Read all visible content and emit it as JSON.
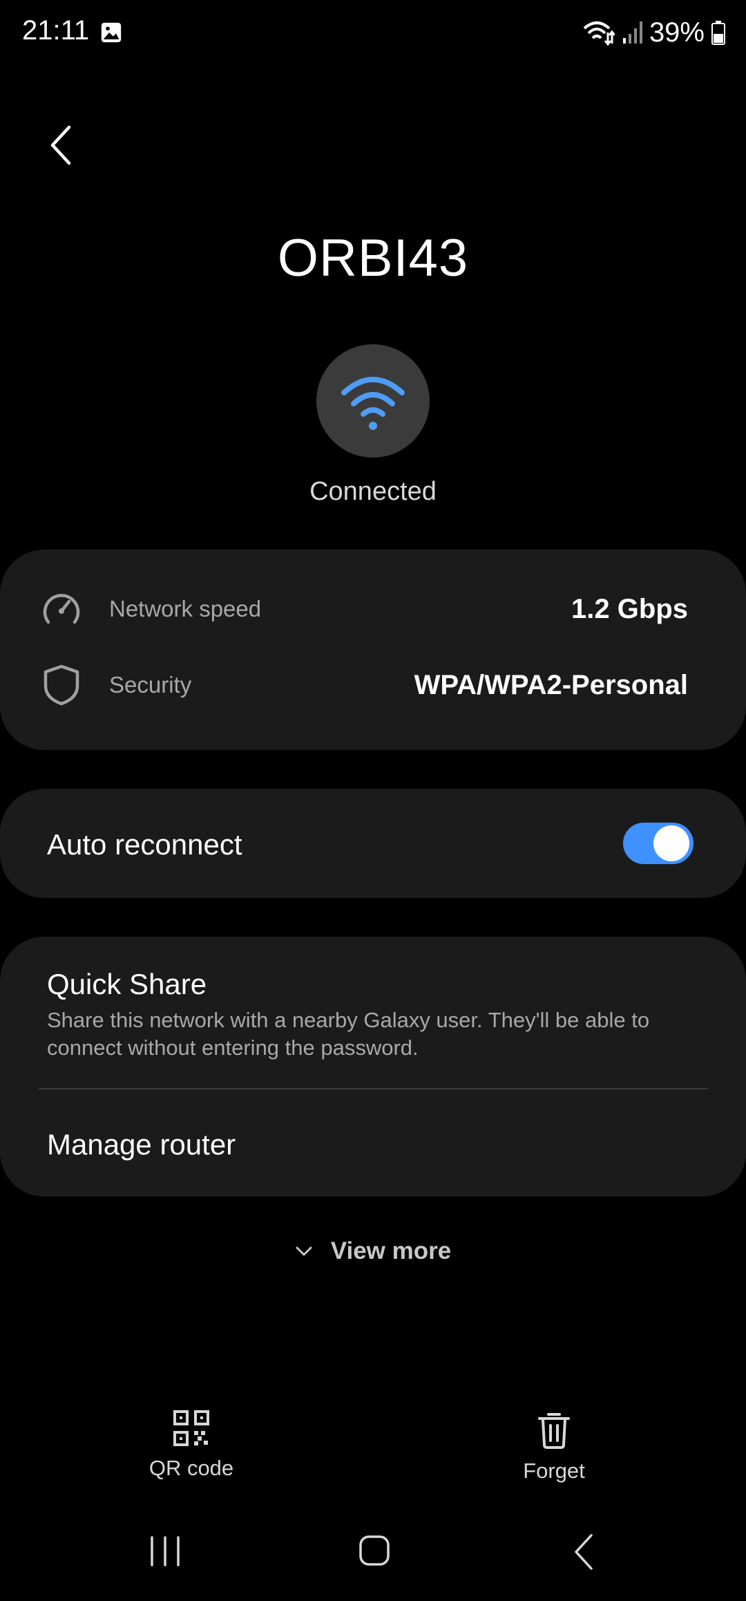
{
  "status_bar": {
    "time": "21:11",
    "battery": "39%",
    "icons": [
      "gallery-icon",
      "wifi-data-icon",
      "signal-icon",
      "battery-icon"
    ]
  },
  "header": {
    "network_name": "ORBI43",
    "status": "Connected"
  },
  "info": {
    "speed_label": "Network speed",
    "speed_value": "1.2 Gbps",
    "security_label": "Security",
    "security_value": "WPA/WPA2-Personal"
  },
  "auto_reconnect": {
    "label": "Auto reconnect",
    "enabled": true
  },
  "quick_share": {
    "title": "Quick Share",
    "description": "Share this network with a nearby Galaxy user. They'll be able to connect without entering the password."
  },
  "manage_router": {
    "label": "Manage router"
  },
  "view_more": {
    "label": "View more"
  },
  "actions": {
    "qr_code": "QR code",
    "forget": "Forget"
  },
  "colors": {
    "accent": "#3e91ff",
    "wifi_icon": "#4f9cf5",
    "card_bg": "#1b1b1b"
  }
}
